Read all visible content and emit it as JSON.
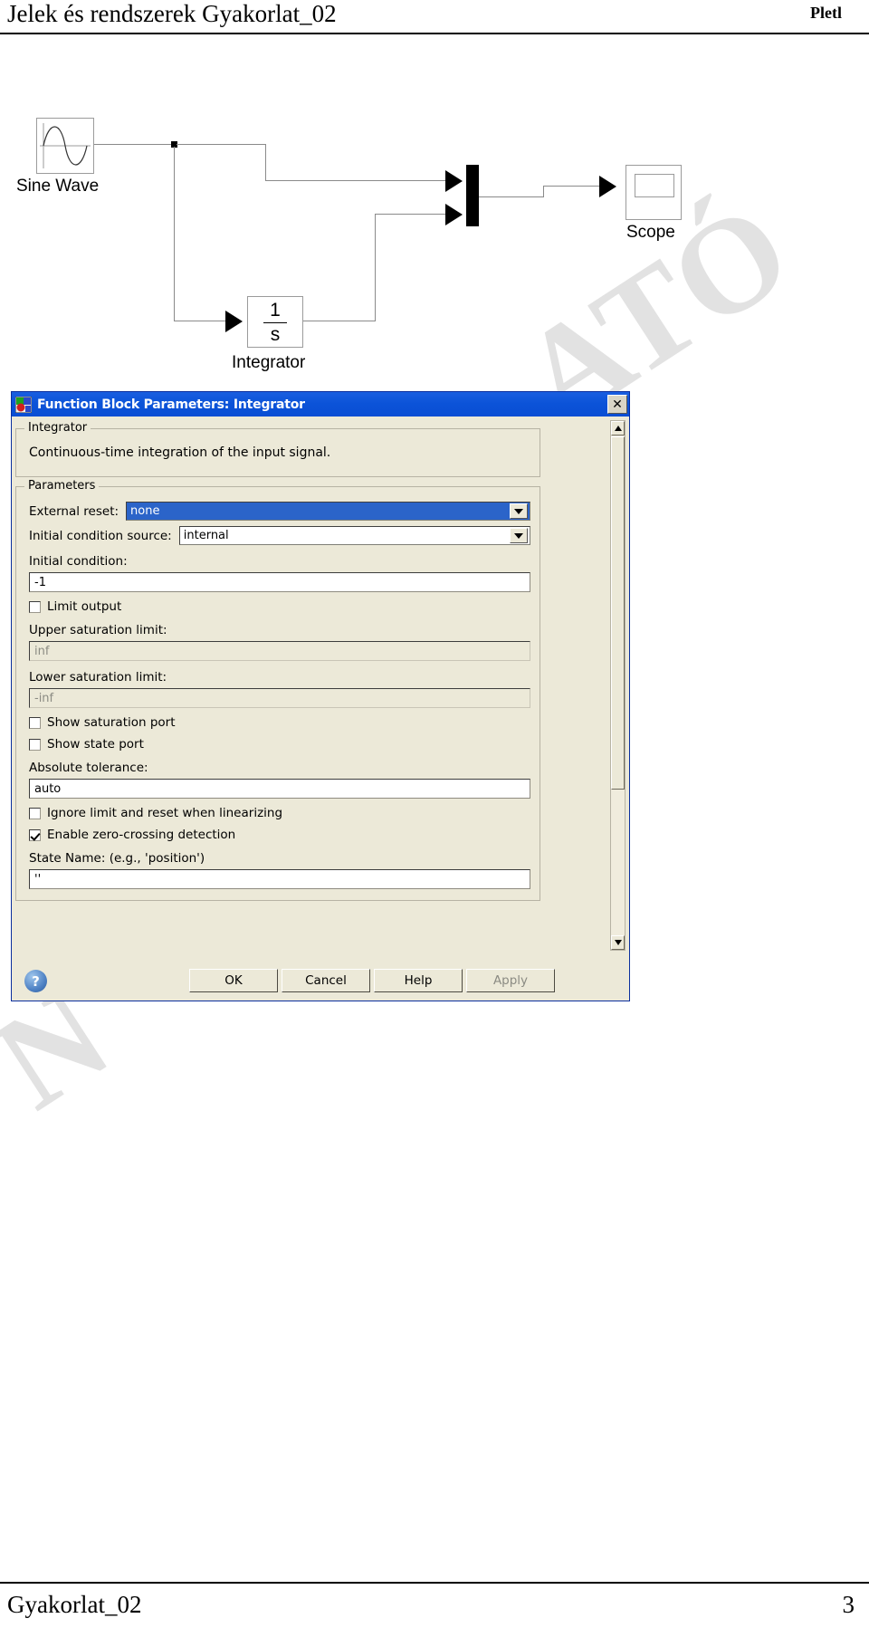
{
  "header": {
    "title": "Jelek és rendszerek Gyakorlat_02",
    "author": "Pletl"
  },
  "footer": {
    "title": "Gyakorlat_02",
    "page_number": "3"
  },
  "watermark": {
    "line_a": "ATÓ",
    "line_b": "N"
  },
  "model": {
    "sine_label": "Sine Wave",
    "scope_label": "Scope",
    "integrator_label": "Integrator",
    "integrator_numerator": "1",
    "integrator_denominator": "s"
  },
  "dialog": {
    "title": "Function Block Parameters: Integrator",
    "close_label": "✕",
    "group_integrator": {
      "title": "Integrator",
      "description": "Continuous-time integration of the input signal."
    },
    "group_parameters": {
      "title": "Parameters",
      "external_reset_label": "External reset:",
      "external_reset_value": "none",
      "ic_source_label": "Initial condition source:",
      "ic_source_value": "internal",
      "initial_condition_label": "Initial condition:",
      "initial_condition_value": "-1",
      "limit_output_label": "Limit output",
      "upper_sat_label": "Upper saturation limit:",
      "upper_sat_value": "inf",
      "lower_sat_label": "Lower saturation limit:",
      "lower_sat_value": "-inf",
      "show_saturation_port_label": "Show saturation port",
      "show_state_port_label": "Show state port",
      "abs_tolerance_label": "Absolute tolerance:",
      "abs_tolerance_value": "auto",
      "ignore_limit_label": "Ignore limit and reset when linearizing",
      "zero_crossing_label": "Enable zero-crossing detection",
      "state_name_label": "State Name: (e.g., 'position')",
      "state_name_value": "''"
    },
    "buttons": {
      "help_glyph": "?",
      "ok": "OK",
      "cancel": "Cancel",
      "help": "Help",
      "apply": "Apply"
    }
  },
  "colors": {
    "titlebar_blue": "#0a4ed4",
    "dialog_face": "#ece9d8",
    "selection_blue": "#2b64c9",
    "wire_gray": "#8a8a8a"
  }
}
